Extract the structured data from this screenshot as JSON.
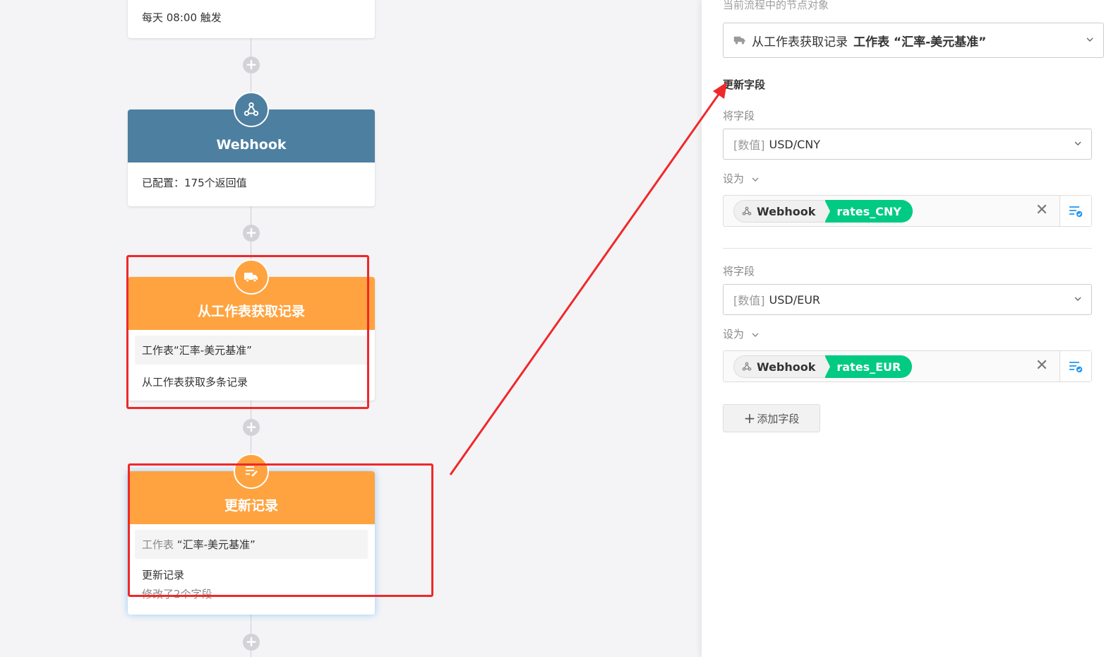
{
  "canvas": {
    "trigger_card": {
      "text": "每天 08:00 触发"
    },
    "webhook_node": {
      "title": "Webhook",
      "body": "已配置：175个返回值"
    },
    "fetch_node": {
      "title": "从工作表获取记录",
      "sheet_line": "工作表“汇率-美元基准”",
      "desc": "从工作表获取多条记录"
    },
    "update_node": {
      "title": "更新记录",
      "sheet_prefix": "工作表",
      "sheet_name": "“汇率-美元基准”",
      "desc": "更新记录",
      "modified": "修改了2个字段"
    },
    "add_symbol": "+"
  },
  "panel": {
    "top_label": "当前流程中的节点对象",
    "node_select": {
      "prefix": "从工作表获取记录",
      "bold": "工作表 “汇率-美元基准”"
    },
    "section_title": "更新字段",
    "fields": [
      {
        "field_label": "将字段",
        "field_tag": "[数值]",
        "field_value": "USD/CNY",
        "set_label": "设为",
        "chip_source": "Webhook",
        "chip_value": "rates_CNY"
      },
      {
        "field_label": "将字段",
        "field_tag": "[数值]",
        "field_value": "USD/EUR",
        "set_label": "设为",
        "chip_source": "Webhook",
        "chip_value": "rates_EUR"
      }
    ],
    "add_field_button": "添加字段",
    "clear_symbol": "✕"
  },
  "colors": {
    "webhook_blue": "#4d7fa0",
    "node_orange": "#ffa340",
    "chip_green": "#01ca83",
    "annotation_red": "#f0282a"
  }
}
